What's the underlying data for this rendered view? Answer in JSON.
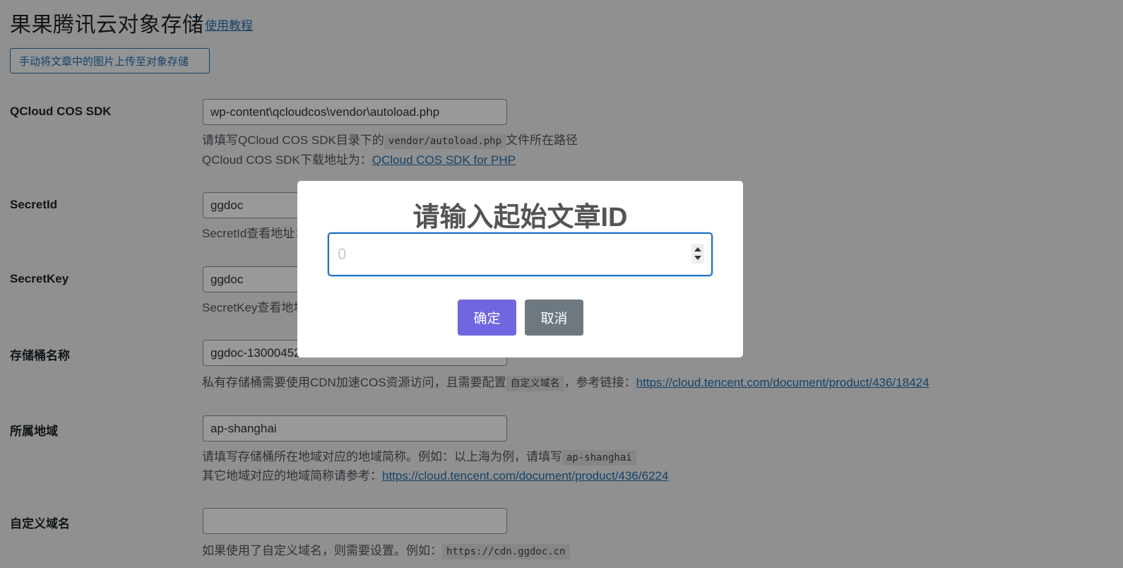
{
  "page": {
    "title": "果果腾讯云对象存储",
    "tutorial_link": "使用教程",
    "upload_button": "手动将文章中的图片上传至对象存储"
  },
  "fields": {
    "sdk": {
      "label": "QCloud COS SDK",
      "value": "wp-content\\qcloudcos\\vendor\\autoload.php",
      "desc1_prefix": "请填写QCloud COS SDK目录下的",
      "desc1_code": "vendor/autoload.php",
      "desc1_suffix": "文件所在路径",
      "desc2_prefix": "QCloud COS SDK下载地址为：",
      "desc2_link": "QCloud COS SDK for PHP"
    },
    "secret_id": {
      "label": "SecretId",
      "value": "ggdoc",
      "desc": "SecretId查看地址："
    },
    "secret_key": {
      "label": "SecretKey",
      "value": "ggdoc",
      "desc": "SecretKey查看地址："
    },
    "bucket": {
      "label": "存储桶名称",
      "value": "ggdoc-1300045276",
      "desc_prefix": "私有存储桶需要使用CDN加速COS资源访问，且需要配置",
      "desc_code": "自定义域名",
      "desc_middle": "，参考链接：",
      "desc_link": "https://cloud.tencent.com/document/product/436/18424"
    },
    "region": {
      "label": "所属地域",
      "value": "ap-shanghai",
      "desc1_prefix": "请填写存储桶所在地域对应的地域简称。例如：以上海为例，请填写",
      "desc1_code": "ap-shanghai",
      "desc2_prefix": "其它地域对应的地域简称请参考：",
      "desc2_link": "https://cloud.tencent.com/document/product/436/6224"
    },
    "domain": {
      "label": "自定义域名",
      "value": "",
      "desc_prefix": "如果使用了自定义域名，则需要设置。例如：",
      "desc_code": "https://cdn.ggdoc.cn"
    }
  },
  "modal": {
    "title": "请输入起始文章ID",
    "input_placeholder": "0",
    "input_value": "",
    "confirm_label": "确定",
    "cancel_label": "取消"
  },
  "colors": {
    "accent": "#2271b1",
    "confirm": "#7066e0",
    "cancel": "#6e7881",
    "focus": "#1e6fc9"
  }
}
